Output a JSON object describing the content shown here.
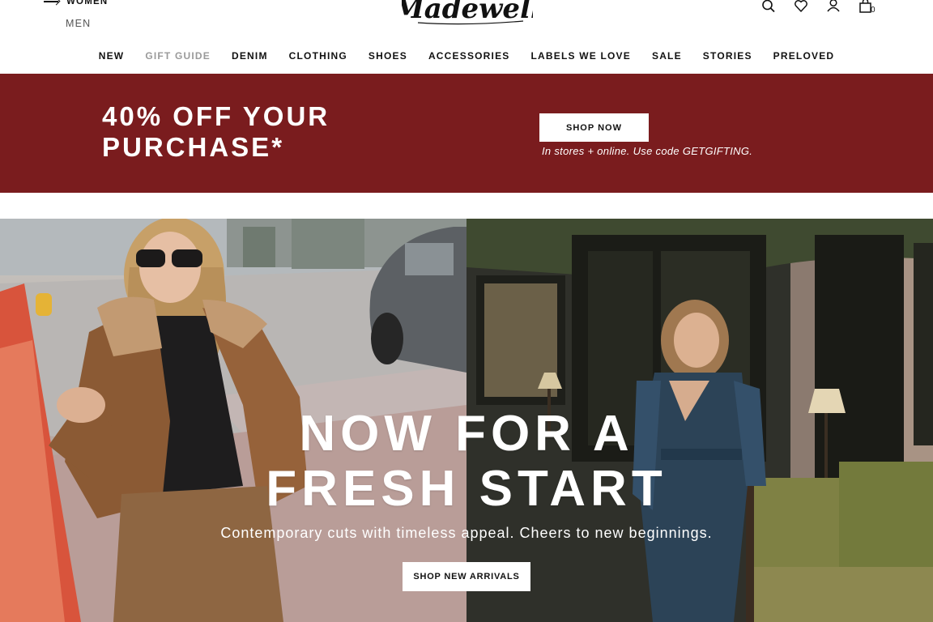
{
  "header": {
    "gender_active": "WOMEN",
    "gender_other": "MEN",
    "logo_text": "Madewell",
    "bag_count": "0",
    "icons": [
      "search-icon",
      "heart-icon",
      "account-icon",
      "bag-icon"
    ]
  },
  "nav": {
    "items": [
      {
        "label": "NEW"
      },
      {
        "label": "GIFT GUIDE"
      },
      {
        "label": "DENIM"
      },
      {
        "label": "CLOTHING"
      },
      {
        "label": "SHOES"
      },
      {
        "label": "ACCESSORIES"
      },
      {
        "label": "LABELS WE LOVE"
      },
      {
        "label": "SALE"
      },
      {
        "label": "STORIES"
      },
      {
        "label": "PRELOVED"
      }
    ]
  },
  "promo": {
    "headline": "40% OFF YOUR PURCHASE*",
    "button_label": "SHOP NOW",
    "note": "In stores + online. Use code GETGIFTING.",
    "background_color": "#7a1c1e"
  },
  "hero": {
    "title_line1": "NOW FOR A",
    "title_line2": "FRESH START",
    "subtitle": "Contemporary cuts with timeless appeal. Cheers to new beginnings.",
    "button_label": "SHOP NEW ARRIVALS"
  }
}
